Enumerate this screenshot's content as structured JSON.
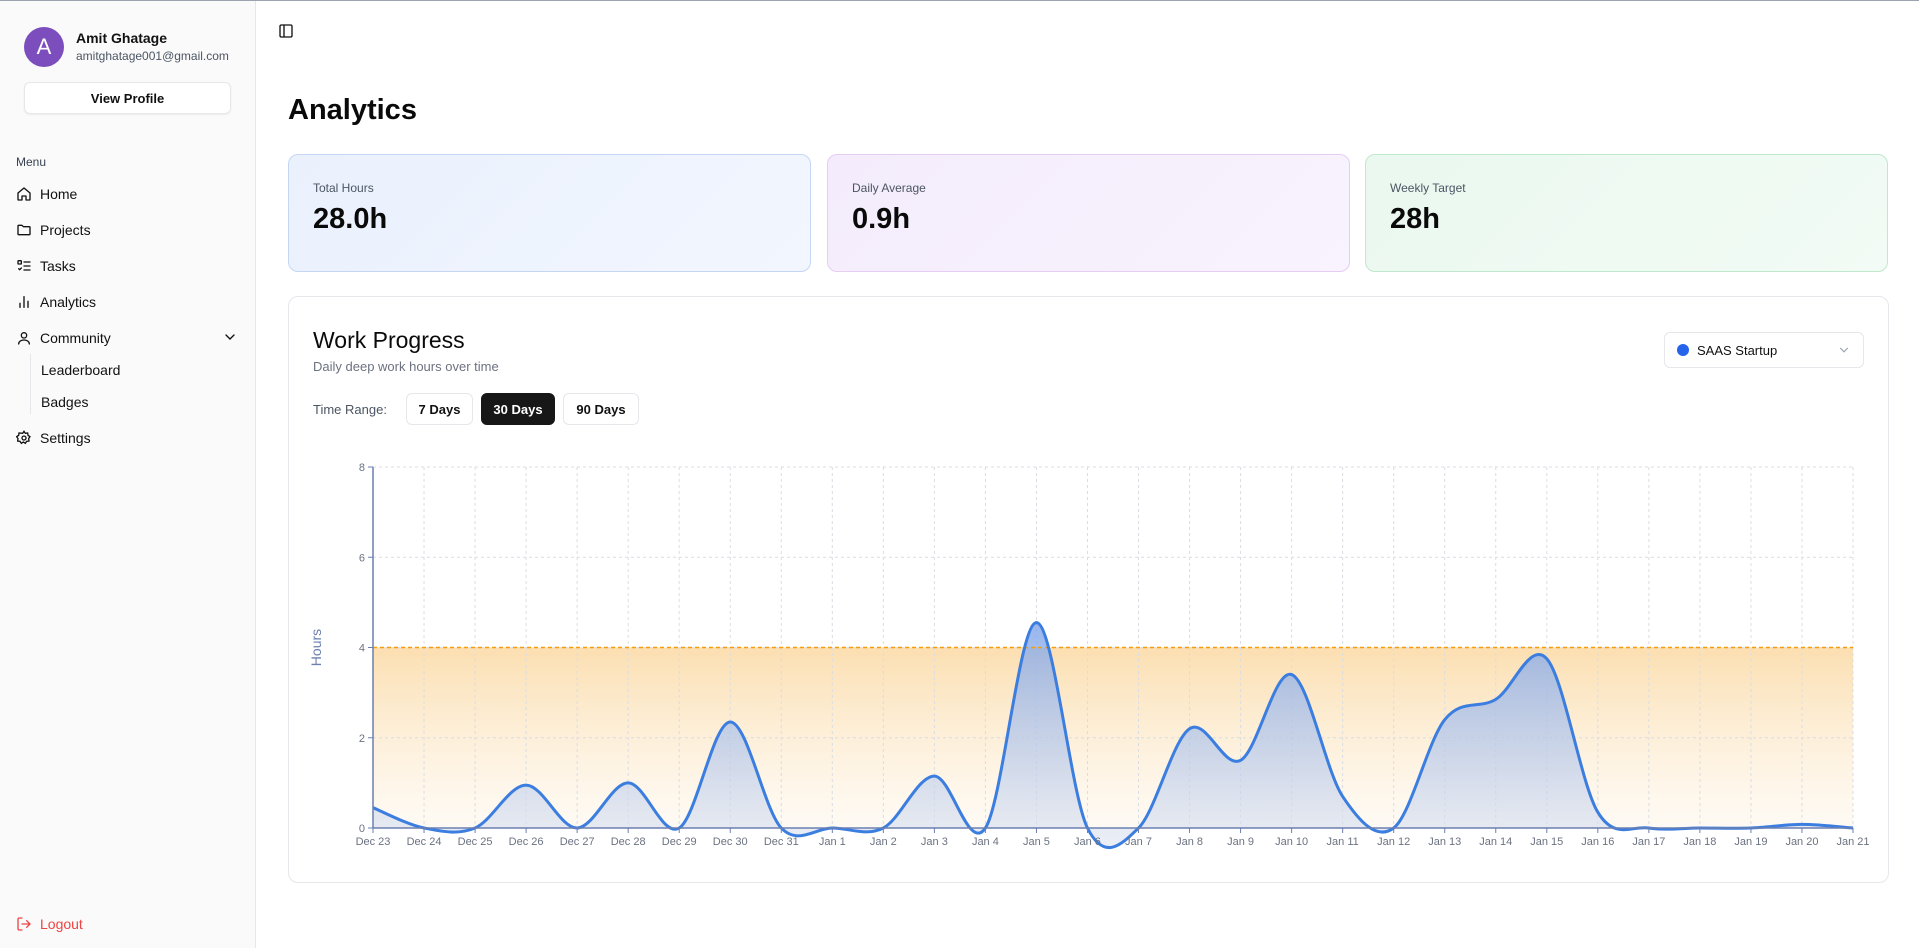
{
  "profile": {
    "initial": "A",
    "name": "Amit Ghatage",
    "email": "amitghatage001@gmail.com",
    "view_profile_label": "View Profile"
  },
  "sidebar": {
    "menu_label": "Menu",
    "items": [
      {
        "label": "Home",
        "icon": "home-icon"
      },
      {
        "label": "Projects",
        "icon": "folder-icon"
      },
      {
        "label": "Tasks",
        "icon": "list-todo-icon"
      },
      {
        "label": "Analytics",
        "icon": "bar-chart-icon"
      },
      {
        "label": "Community",
        "icon": "user-icon"
      }
    ],
    "sub_items": [
      "Leaderboard",
      "Badges"
    ],
    "settings_label": "Settings",
    "logout_label": "Logout"
  },
  "page": {
    "title": "Analytics"
  },
  "stats": [
    {
      "label": "Total Hours",
      "value": "28.0h"
    },
    {
      "label": "Daily Average",
      "value": "0.9h"
    },
    {
      "label": "Weekly Target",
      "value": "28h"
    }
  ],
  "work_progress": {
    "title": "Work Progress",
    "subtitle": "Daily deep work hours over time",
    "time_range_label": "Time Range:",
    "ranges": [
      "7 Days",
      "30 Days",
      "90 Days"
    ],
    "active_range": "30 Days",
    "project": "SAAS Startup",
    "project_color": "#2563eb"
  },
  "chart_data": {
    "type": "area",
    "title": "",
    "xlabel": "",
    "ylabel": "Hours",
    "ylim": [
      0,
      8
    ],
    "yticks": [
      0,
      2,
      4,
      6,
      8
    ],
    "grid": true,
    "target_line": 4,
    "x": [
      "Dec 23",
      "Dec 24",
      "Dec 25",
      "Dec 26",
      "Dec 27",
      "Dec 28",
      "Dec 29",
      "Dec 30",
      "Dec 31",
      "Jan 1",
      "Jan 2",
      "Jan 3",
      "Jan 4",
      "Jan 5",
      "Jan 6",
      "Jan 7",
      "Jan 8",
      "Jan 9",
      "Jan 10",
      "Jan 11",
      "Jan 12",
      "Jan 13",
      "Jan 14",
      "Jan 15",
      "Jan 16",
      "Jan 17",
      "Jan 18",
      "Jan 19",
      "Jan 20",
      "Jan 21"
    ],
    "series": [
      {
        "values": [
          0.45,
          0,
          0,
          0.95,
          0,
          1.0,
          0,
          2.35,
          0,
          0,
          0,
          1.15,
          0,
          4.55,
          0,
          0,
          2.2,
          1.5,
          3.4,
          0.7,
          0,
          2.4,
          2.85,
          3.75,
          0.35,
          0,
          0,
          0,
          0.08,
          0
        ]
      }
    ],
    "colors": {
      "line": "#3b7ee0",
      "target": "#f59e0b"
    }
  }
}
